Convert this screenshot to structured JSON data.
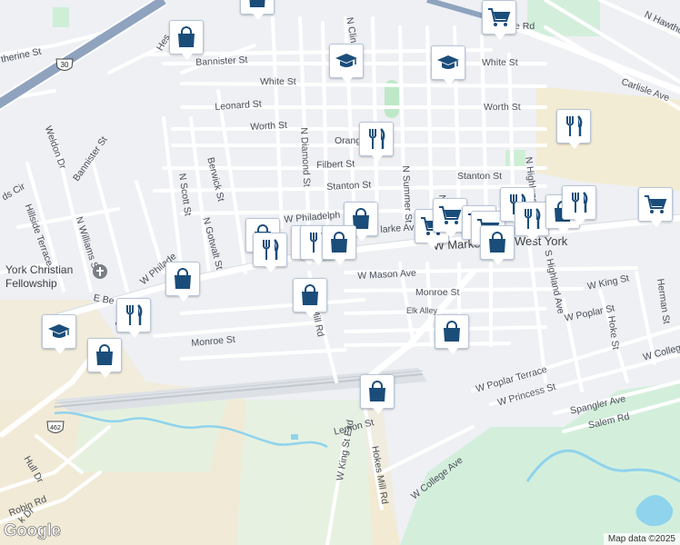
{
  "map": {
    "attribution": "Map data ©2025",
    "logo": "Google",
    "place_labels": {
      "west_york": "West York",
      "fellowship_line1": "York Christian",
      "fellowship_line2": "Fellowship"
    },
    "route_badges": [
      "30",
      "462"
    ],
    "streets": [
      "Hes",
      "Bannister St",
      "therine St",
      "White St",
      "White St",
      "Leonard St",
      "Worth St",
      "Worth St",
      "N Diamond St",
      "N Clin",
      "Orang",
      "Filbert St",
      "Stanton St",
      "Stanton St",
      "W Philadelph",
      "larke Av",
      "W Market St",
      "N Summer St",
      "N Highland Ave",
      "S Highland Ave",
      "Carlisle Ave",
      "N Hawtho",
      "e Rd",
      "Weldon Dr",
      "Bannister St",
      "ds Cir",
      "Hillside Terrace",
      "N Williams St",
      "N Scott St",
      "Berwick St",
      "N Gotwalt St",
      "W Philade",
      "W Mason Ave",
      "Monroe St",
      "Elk Alley",
      "Monroe St",
      "W King St",
      "W Poplar St",
      "Hoke St",
      "Herman St",
      "W College",
      "W Poplar Terrace",
      "W Princess St",
      "Spangler Ave",
      "Salem Rd",
      "Lemon St",
      "Hokes Mill Rd",
      "W College Ave",
      "W King St Exd",
      "Hull Dr",
      "Robin Rd",
      "k Dr",
      "E Be",
      "arke",
      "Mill Rd",
      "N S"
    ]
  },
  "markers": [
    {
      "icon": "shopping-bag",
      "label": "shopping-bag-marker"
    },
    {
      "icon": "fork-knife",
      "label": "restaurant-marker"
    },
    {
      "icon": "graduation-cap",
      "label": "school-marker"
    },
    {
      "icon": "shopping-cart",
      "label": "grocery-marker"
    }
  ],
  "colors": {
    "land": "#eef0f4",
    "road": "#ffffff",
    "highway": "#8fa3bf",
    "park": "#d3efdc",
    "sand": "#f2ead2",
    "water": "#8fd3ec",
    "icon": "#1b4d7a"
  }
}
